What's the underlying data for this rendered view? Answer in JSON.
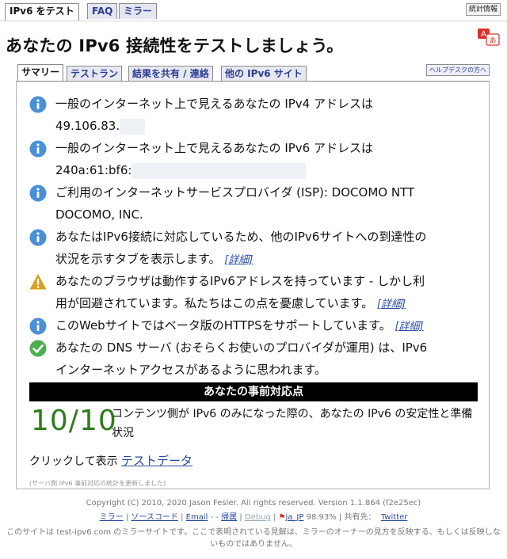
{
  "nav": {
    "tabs": [
      "IPv6 をテスト",
      "FAQ",
      "ミラー"
    ],
    "stats_button": "統計情報"
  },
  "page_title": "あなたの IPv6 接続性をテストしましょう。",
  "subtabs": [
    "サマリー",
    "テストラン",
    "結果を共有 / 連絡",
    "他の IPv6 サイト"
  ],
  "help_button": "ヘルプデスクの方へ",
  "messages": [
    {
      "icon": "info-icon",
      "line1": "一般のインターネット上で見えるあなたの IPv4 アドレスは",
      "line2": "49.106.83."
    },
    {
      "icon": "info-icon",
      "line1": "一般のインターネット上で見えるあなたの IPv6 アドレスは",
      "line2": "240a:61:bf6:"
    },
    {
      "icon": "info-icon",
      "line1": "ご利用のインターネットサービスプロバイダ (ISP): DOCOMO NTT",
      "line2": "DOCOMO, INC."
    },
    {
      "icon": "info-icon",
      "line1": "あなたはIPv6接続に対応しているため、他のIPv6サイトへの到達性の",
      "line2": "状況を示すタブを表示します。",
      "detail": "[詳細]"
    },
    {
      "icon": "warning-icon",
      "line1": "あなたのブラウザは動作するIPv6アドレスを持っています - しかし利",
      "line2": "用が回避されています。私たちはこの点を憂慮しています。",
      "detail": "[詳細]"
    },
    {
      "icon": "info-icon",
      "line1": "このWebサイトではベータ版のHTTPSをサポートしています。",
      "detail": "[詳細]"
    },
    {
      "icon": "check-icon",
      "line1": "あなたの DNS サーバ (おそらくお使いのプロバイダが運用) は、IPv6",
      "line2": "インターネットアクセスがあるように思われます。"
    }
  ],
  "readiness": {
    "header": "あなたの事前対応点",
    "score": "10/10",
    "description": "コンテンツ側が IPv6 のみになった際の、あなたの IPv6 の安定性と準備状況"
  },
  "click_show": {
    "prefix": "クリックして表示",
    "link": "テストデータ"
  },
  "updated_note": "(サーバ側 IPv6 事前対応の統計を更新しました)",
  "footer": {
    "copyright": "Copyright (C) 2010, 2020 Jason Fesler. All rights reserved. Version 1.1.864 (f2e25ec)",
    "mirror": "ミラー",
    "source": "ソースコード",
    "email": "Email",
    "sep1": "-",
    "sep2": "-",
    "attribution": "帰属",
    "debug": "Debug",
    "locale": "ja_JP",
    "percent": "98.93%",
    "share": "共有先：",
    "twitter": "Twitter",
    "mirror_note": "このサイトは test-ipv6.com のミラーサイトです。ここで表明されている見解は、ミラーのオーナーの見方を反映する、もしくは反映しないものではありません。"
  },
  "colors": {
    "link": "#2a4aa0",
    "score": "#2e7d1a",
    "info": "#4a90d9",
    "warning": "#d9a01e",
    "ok": "#4caf50"
  }
}
